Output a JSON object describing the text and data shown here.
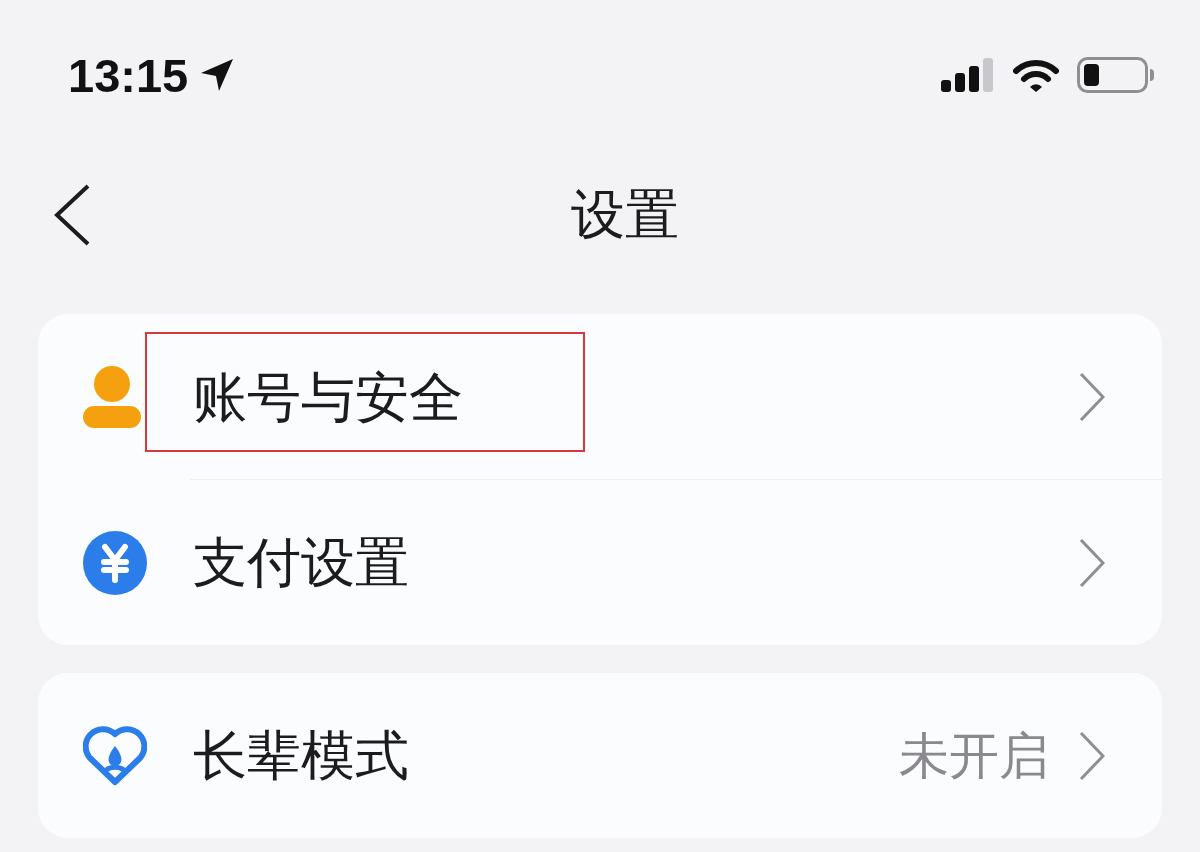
{
  "status_bar": {
    "time": "13:15"
  },
  "nav_bar": {
    "title": "设置"
  },
  "groups": [
    {
      "items": [
        {
          "kind": "account",
          "label": "账号与安全",
          "highlighted": true
        },
        {
          "kind": "payment",
          "label": "支付设置",
          "highlighted": false
        }
      ]
    },
    {
      "items": [
        {
          "kind": "elder",
          "label": "长辈模式",
          "value": "未开启",
          "highlighted": false
        }
      ]
    }
  ]
}
